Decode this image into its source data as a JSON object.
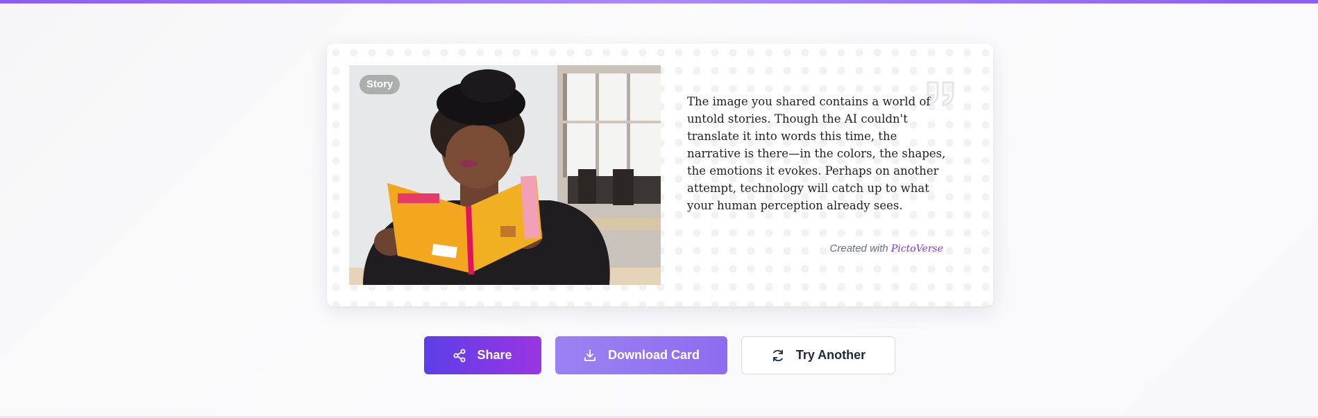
{
  "card": {
    "badge": "Story",
    "story": "The image you shared contains a world of untold stories. Though the AI couldn't translate it into words this time, the narrative is there—in the colors, the shapes, the emotions it evokes. Perhaps on another attempt, technology will catch up to what your human perception already sees.",
    "credit_prefix": "Created with",
    "credit_brand": "PictoVerse"
  },
  "actions": {
    "share_label": "Share",
    "download_label": "Download Card",
    "try_label": "Try Another"
  },
  "colors": {
    "accent": "#7c3aed",
    "share_gradient_start": "#5b3fe6",
    "share_gradient_end": "#9b35e3",
    "download_bg": "#9079f1",
    "top_bar": "#8b5cf6"
  },
  "icons": {
    "share": "share-icon",
    "download": "download-icon",
    "refresh": "refresh-icon",
    "quote": "quote-icon"
  }
}
